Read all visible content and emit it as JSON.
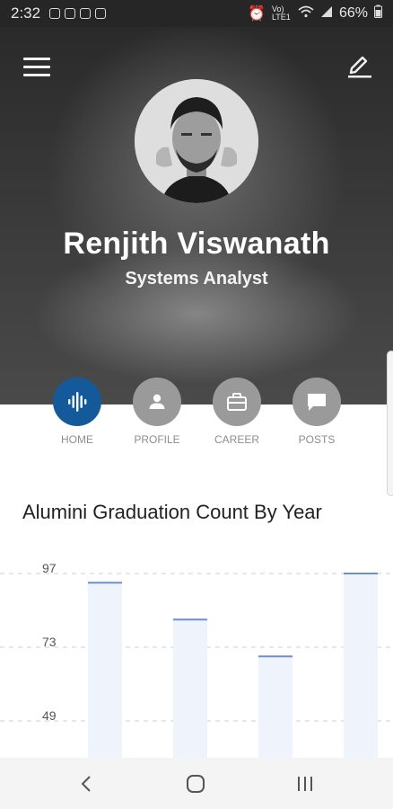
{
  "status": {
    "time": "2:32",
    "battery": "66%",
    "network": "Vo) LTE1"
  },
  "profile": {
    "name": "Renjith Viswanath",
    "role": "Systems Analyst"
  },
  "nav": [
    {
      "label": "HOME",
      "icon": "audio-wave-icon",
      "active": true
    },
    {
      "label": "PROFILE",
      "icon": "person-icon",
      "active": false
    },
    {
      "label": "CAREER",
      "icon": "briefcase-icon",
      "active": false
    },
    {
      "label": "POSTS",
      "icon": "chat-bubble-icon",
      "active": false
    }
  ],
  "chart_title": "Alumini Graduation Count By Year",
  "chart_data": {
    "type": "bar",
    "title": "Alumini Graduation Count By Year",
    "yticks": [
      97,
      73,
      49
    ],
    "ylim": [
      40,
      97
    ],
    "values": [
      94,
      82,
      70,
      97
    ],
    "grid": true,
    "bar_color": "#eff3fc",
    "cap_color": "#6c8fd1"
  },
  "colors": {
    "accent": "#145a9b",
    "inactive": "#9a9a9a"
  }
}
